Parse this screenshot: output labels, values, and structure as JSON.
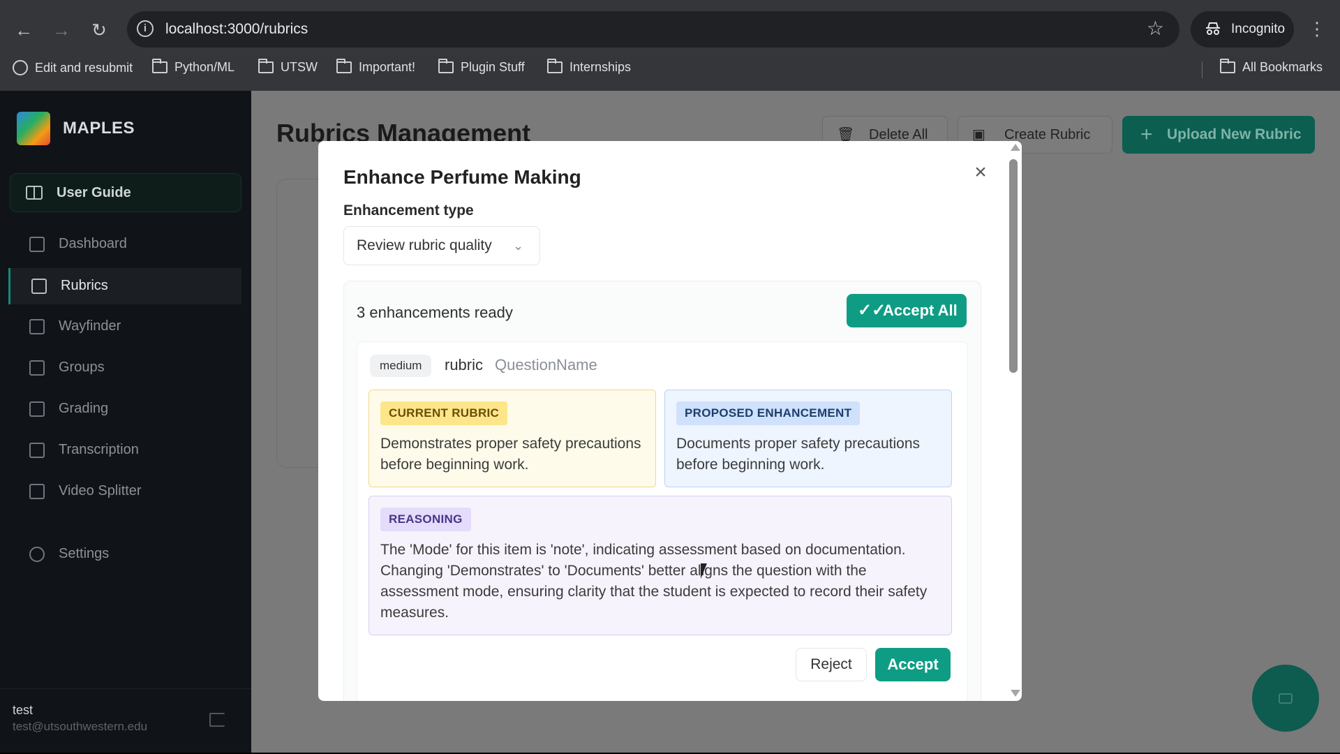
{
  "browser": {
    "url": "localhost:3000/rubrics",
    "incognito_label": "Incognito",
    "bookmarks": [
      "Edit and resubmit",
      "Python/ML",
      "UTSW",
      "Important!",
      "Plugin Stuff",
      "Internships"
    ],
    "all_bookmarks": "All Bookmarks"
  },
  "sidebar": {
    "brand": "MAPLES",
    "user_guide": "User Guide",
    "items": [
      {
        "label": "Dashboard",
        "icon": "dashboard-icon"
      },
      {
        "label": "Rubrics",
        "icon": "document-icon",
        "active": true
      },
      {
        "label": "Wayfinder",
        "icon": "robot-icon"
      },
      {
        "label": "Groups",
        "icon": "groups-icon"
      },
      {
        "label": "Grading",
        "icon": "clipboard-icon"
      },
      {
        "label": "Transcription",
        "icon": "audio-wave-icon"
      },
      {
        "label": "Video Splitter",
        "icon": "scissors-icon"
      }
    ],
    "settings": "Settings",
    "user": {
      "name": "test",
      "email": "test@utsouthwestern.edu"
    }
  },
  "main": {
    "title": "Rubrics Management",
    "delete_all": "Delete All",
    "create_rubric": "Create Rubric",
    "upload_new": "Upload New Rubric"
  },
  "modal": {
    "title": "Enhance Perfume Making",
    "enhancement_type_label": "Enhancement type",
    "enhancement_type_value": "Review rubric quality",
    "ready_text": "3 enhancements ready",
    "accept_all": "Accept All",
    "enhancement": {
      "severity": "medium",
      "type": "rubric",
      "field": "QuestionName",
      "current_label": "CURRENT RUBRIC",
      "current_text": "Demonstrates proper safety precautions before beginning work.",
      "proposed_label": "PROPOSED ENHANCEMENT",
      "proposed_text": "Documents proper safety precautions before beginning work.",
      "reasoning_label": "REASONING",
      "reasoning_text": "The 'Mode' for this item is 'note', indicating assessment based on documentation. Changing 'Demonstrates' to 'Documents' better aligns the question with the assessment mode, ensuring clarity that the student is expected to record their safety measures.",
      "reject": "Reject",
      "accept": "Accept"
    }
  },
  "colors": {
    "accent": "#0e9d84",
    "sidebar_bg": "#101418",
    "current_bg": "#fffbea",
    "proposed_bg": "#eef5ff",
    "reasoning_bg": "#f6f3fd"
  }
}
